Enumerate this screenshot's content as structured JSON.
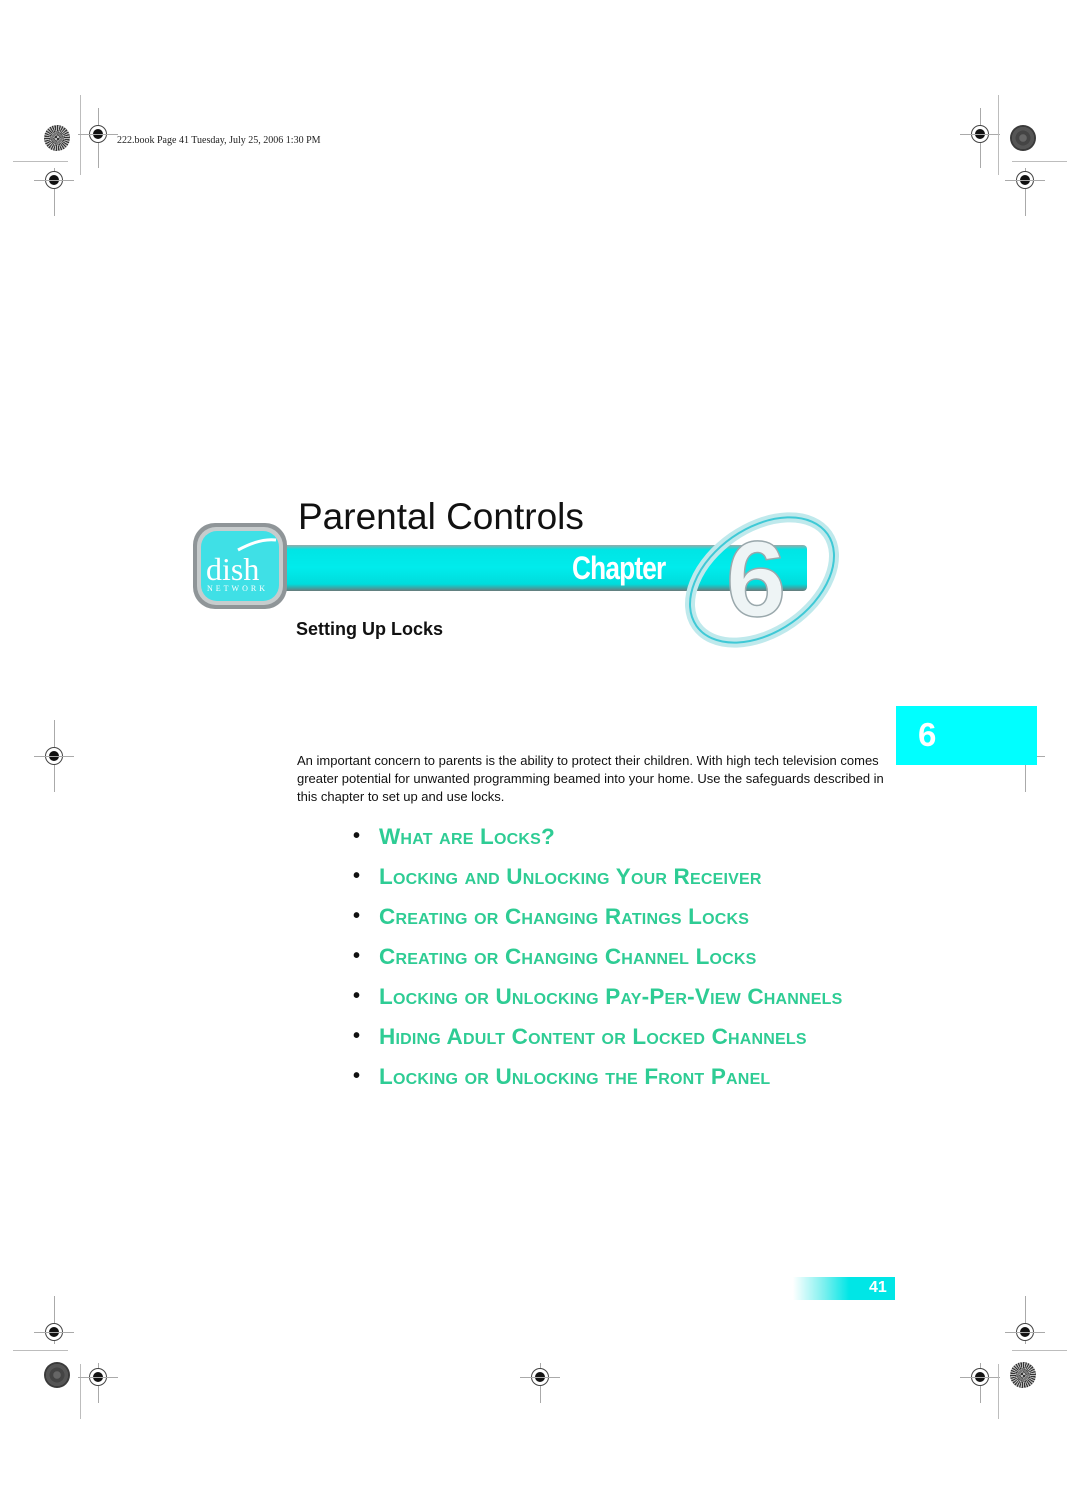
{
  "print_header": "222.book  Page 41  Tuesday, July 25, 2006  1:30 PM",
  "chapter": {
    "title": "Parental Controls",
    "banner_label": "Chapter",
    "number": "6",
    "subtitle": "Setting Up Locks",
    "brand": {
      "logo_text": "dish",
      "logo_subtext": "NETWORK"
    }
  },
  "side_tab": {
    "number": "6",
    "color": "#00ffff"
  },
  "intro": "An important concern to parents is the ability to protect their children. With high tech television comes greater potential for unwanted programming beamed into your home. Use the safeguards described in this chapter to set up and use locks.",
  "toc": {
    "bullet": "•",
    "link_color": "#2ecc94",
    "items": [
      {
        "label": "What are Locks?"
      },
      {
        "label": "Locking and Unlocking Your Receiver"
      },
      {
        "label": "Creating or Changing Ratings Locks"
      },
      {
        "label": "Creating or Changing Channel Locks"
      },
      {
        "label": "Locking or Unlocking Pay-Per-View Channels"
      },
      {
        "label": "Hiding Adult Content or Locked Channels"
      },
      {
        "label": "Locking or Unlocking the Front Panel"
      }
    ]
  },
  "page_number": "41"
}
